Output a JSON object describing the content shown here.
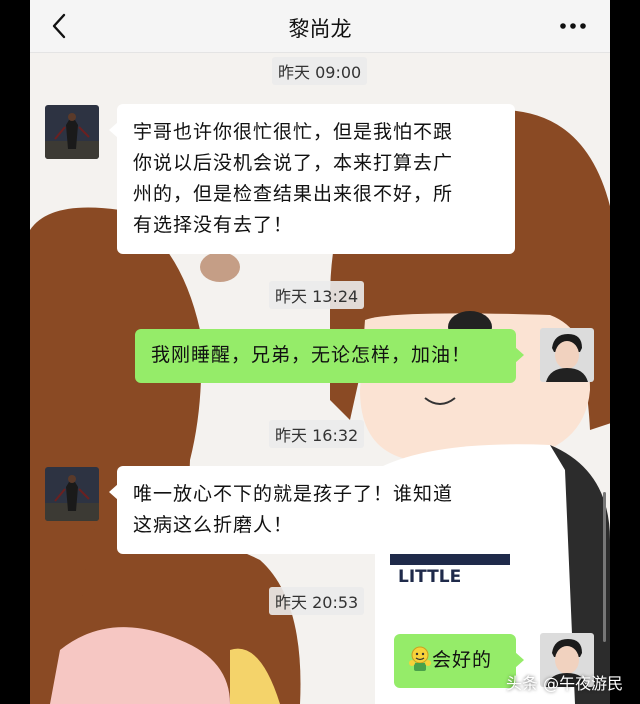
{
  "header": {
    "title": "黎尚龙",
    "back_icon": "chevron-left-icon",
    "more_icon": "more-dots-icon"
  },
  "messages": [
    {
      "time": "昨天 09:00",
      "side": "left",
      "lines": [
        "宇哥也许你很忙很忙，但是我怕不跟",
        "你说以后没机会说了，本来打算去广",
        "州的，但是检查结果出来很不好，所",
        "有选择没有去了！"
      ]
    },
    {
      "time": "昨天 13:24",
      "side": "right",
      "lines": [
        "我刚睡醒，兄弟，无论怎样，加油！"
      ]
    },
    {
      "time": "昨天 16:32",
      "side": "left",
      "lines": [
        "唯一放心不下的就是孩子了！谁知道",
        "这病这么折磨人！"
      ]
    },
    {
      "time": "昨天 20:53",
      "side": "right",
      "emoji": "fighting-emoji-icon",
      "lines": [
        "会好的"
      ]
    }
  ],
  "wallpaper": {
    "shirt_text": "LITTLE"
  },
  "watermark": "头条 @午夜游民",
  "colors": {
    "sent_bubble": "#95ec69",
    "received_bubble": "#ffffff",
    "header_bg": "#f5f5f5"
  }
}
